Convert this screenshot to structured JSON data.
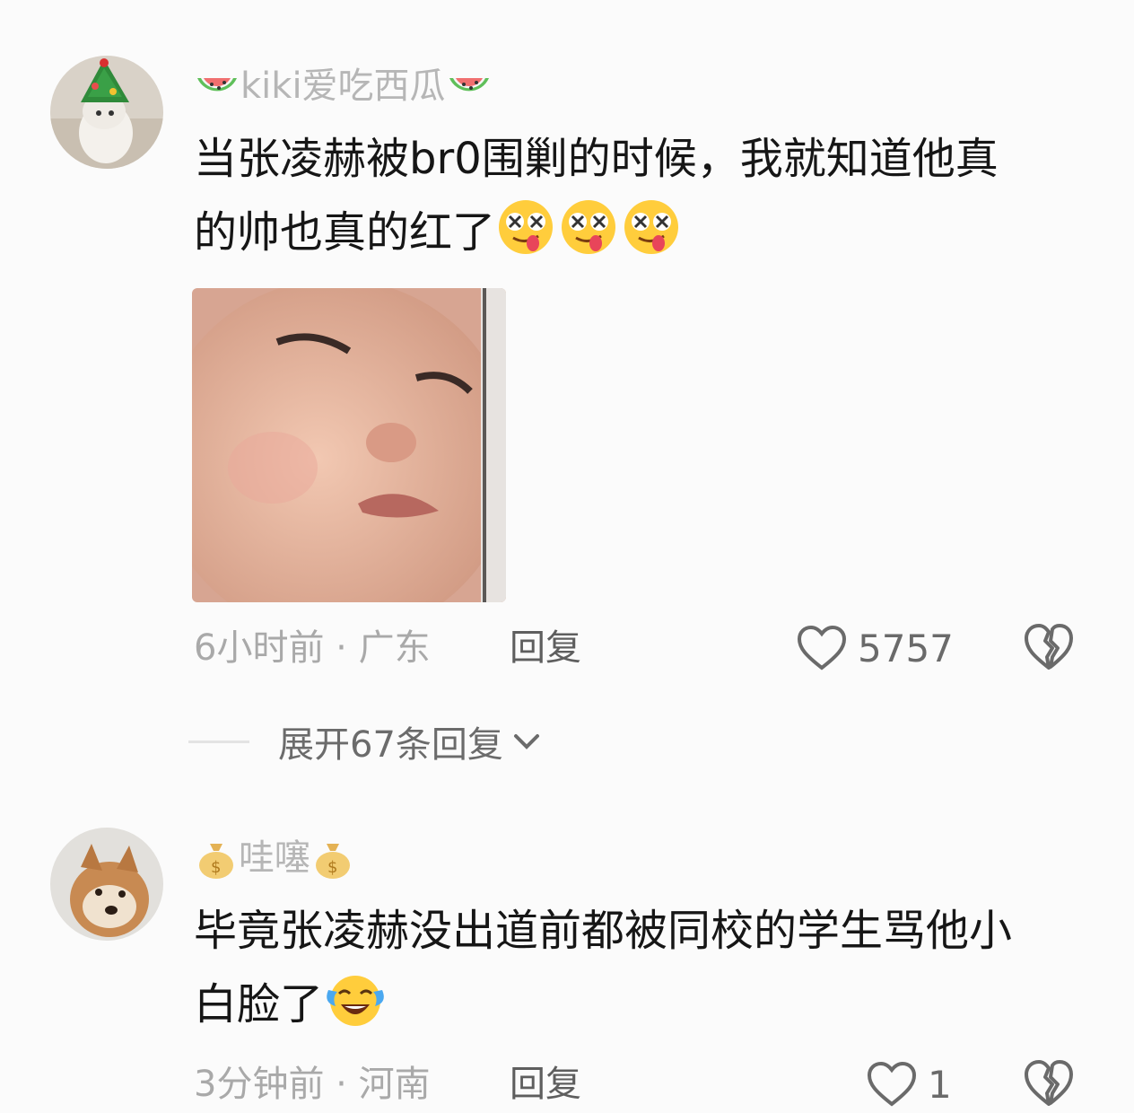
{
  "comments": [
    {
      "username_prefix_icon": "watermelon-emoji",
      "username": "kiki爱吃西瓜",
      "username_suffix_icon": "watermelon-emoji",
      "text_line1": "当张凌赫被br0围剿的时候，我就知道他真",
      "text_line2": "的帅也真的红了",
      "inline_emoji": "dizzy-tongue-face-emoji",
      "time_location": "6小时前 · 广东",
      "reply_label": "回复",
      "like_count": "5757",
      "expand_label": "展开67条回复"
    },
    {
      "username_prefix_icon": "money-bag-emoji",
      "username": "哇噻",
      "username_suffix_icon": "money-bag-emoji",
      "text_line1": "毕竟张凌赫没出道前都被同校的学生骂他小",
      "text_line2": "白脸了",
      "inline_emoji": "crying-laughing-emoji",
      "time_location": "3分钟前 · 河南",
      "reply_label": "回复",
      "like_count": "1"
    }
  ],
  "colors": {
    "background": "#fbfbfb",
    "username": "#b6b6b6",
    "text": "#161616",
    "meta": "#a9a9a9"
  }
}
